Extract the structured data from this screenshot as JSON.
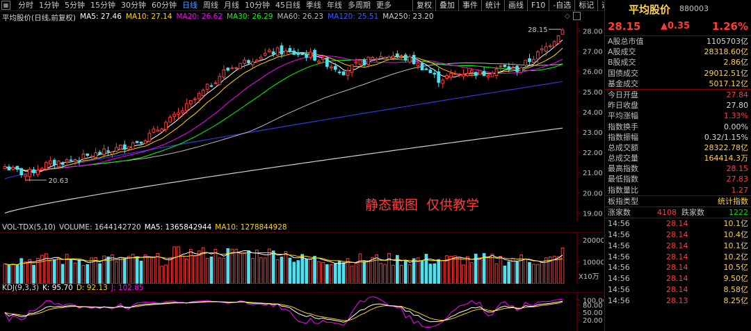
{
  "toolbar": {
    "periods": [
      "分时",
      "1分钟",
      "5分钟",
      "15分钟",
      "30分钟",
      "60分钟",
      "日线",
      "周线",
      "月线",
      "10分钟",
      "45日线",
      "季线",
      "年线",
      "多周期",
      "更多"
    ],
    "active_period": "日线",
    "tools": [
      "复权",
      "叠加",
      "事件",
      "统计",
      "画线",
      "F10",
      "-自选",
      "标记",
      "返回"
    ]
  },
  "chart_info": {
    "name": "平均股价(日线,前复权)",
    "ma5": "MA5: 27.46",
    "ma10": "MA10: 27.14",
    "ma20": "MA20: 26.62",
    "ma30": "MA30: 26.29",
    "ma60": "MA60: 26.23",
    "ma120": "MA120: 25.51",
    "ma250": "MA250: 23.20"
  },
  "colors": {
    "up": "#ff3b3b",
    "down": "#4fe0f0",
    "ma5": "#ffffff",
    "ma10": "#ffd700",
    "ma20": "#ff00ff",
    "ma30": "#00ff00",
    "ma60": "#bbbbbb",
    "ma120": "#2a3bd8",
    "ma250": "#d0d0d0"
  },
  "price_axis": {
    "ticks": [
      "28.00",
      "27.00",
      "26.00",
      "25.00",
      "24.00",
      "23.00",
      "22.00",
      "21.00",
      "20.00",
      "19.00"
    ]
  },
  "annotations": {
    "high_label": "28.15",
    "low_label": "20.63",
    "watermark": "静态截图  仅供教学"
  },
  "volume": {
    "title": "VOL-TDX(5,10)",
    "volume": "VOLUME: 1644142720",
    "ma5": "MA5: 1365842944",
    "ma10": "MA10: 1278844928",
    "ticks": [
      "20000",
      "10000"
    ],
    "unit": "X10万"
  },
  "kdj": {
    "title": "KDJ(9,3,3)",
    "k": "K: 95.70",
    "d": "D: 92.13",
    "j": "J: 102.85",
    "ticks": [
      "100.00",
      "80.00",
      "50.00",
      "20.00"
    ]
  },
  "panel": {
    "name": "平均股价",
    "code": "880003",
    "last": "28.15",
    "change": "▲0.35",
    "pct": "1.26%",
    "stats_a": [
      {
        "k": "A股总市值",
        "v": "1105703亿",
        "c": "#d8d8d8"
      },
      {
        "k": "A股成交",
        "v": "28318.60亿",
        "c": "#ffd24a"
      },
      {
        "k": "B股成交",
        "v": "2.86亿",
        "c": "#ffd24a"
      },
      {
        "k": "国债成交",
        "v": "29012.51亿",
        "c": "#ffd24a"
      },
      {
        "k": "基金成交",
        "v": "5017.12亿",
        "c": "#ffd24a"
      }
    ],
    "stats_b": [
      {
        "k": "今日开盘",
        "v": "27.84",
        "c": "#ff3b3b"
      },
      {
        "k": "昨日收盘",
        "v": "27.80",
        "c": "#d8d8d8"
      },
      {
        "k": "平均涨幅",
        "v": "1.33%",
        "c": "#ff3b3b"
      },
      {
        "k": "指数换手",
        "v": "0.00%",
        "c": "#d8d8d8"
      },
      {
        "k": "指数振幅",
        "v": "0.32/1.15%",
        "c": "#d8d8d8"
      },
      {
        "k": "总成交额",
        "v": "28322.78亿",
        "c": "#ffd24a"
      },
      {
        "k": "总成交量",
        "v": "164414.3万",
        "c": "#ffd24a"
      },
      {
        "k": "最高指数",
        "v": "28.15",
        "c": "#ff3b3b"
      },
      {
        "k": "最低指数",
        "v": "27.83",
        "c": "#ff3b3b"
      },
      {
        "k": "指数量比",
        "v": "1.27",
        "c": "#ff3b3b"
      }
    ],
    "type_label": "板指类型",
    "type_value": "统计指数",
    "up_label": "涨家数",
    "up_count": "4108",
    "down_label": "跌家数",
    "down_count": "1222",
    "ticks": [
      {
        "t": "14:56",
        "p": "28.14",
        "q": "10.1亿"
      },
      {
        "t": "14:56",
        "p": "28.14",
        "q": "10.4亿"
      },
      {
        "t": "14:56",
        "p": "28.14",
        "q": "10.1亿"
      },
      {
        "t": "14:56",
        "p": "28.14",
        "q": "10.2亿"
      },
      {
        "t": "14:56",
        "p": "28.14",
        "q": "10.5亿"
      },
      {
        "t": "14:56",
        "p": "28.14",
        "q": "9.50亿"
      },
      {
        "t": "14:56",
        "p": "28.14",
        "q": "8.58亿"
      },
      {
        "t": "14:56",
        "p": "28.13",
        "q": "8.25亿"
      }
    ]
  }
}
